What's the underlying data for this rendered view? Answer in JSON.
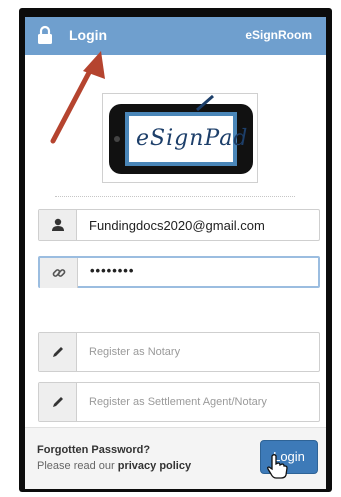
{
  "header": {
    "title": "Login",
    "brand": "eSignRoom"
  },
  "logo": {
    "text": "eSignPad"
  },
  "form": {
    "email_value": "Fundingdocs2020@gmail.com",
    "password_value": "••••••••",
    "notary_placeholder": "Register as Notary",
    "settlement_placeholder": "Register as Settlement Agent/Notary"
  },
  "footer": {
    "forgot_label": "Forgotten Password?",
    "privacy_prefix": "Please read our",
    "privacy_link": "privacy policy",
    "login_label": "Login"
  },
  "colors": {
    "header": "#6f9fce",
    "button": "#3d7ab8",
    "arrow": "#b5442f"
  },
  "icons": [
    "lock-icon",
    "user-icon",
    "link-icon",
    "pencil-icon",
    "hand-cursor-icon"
  ]
}
